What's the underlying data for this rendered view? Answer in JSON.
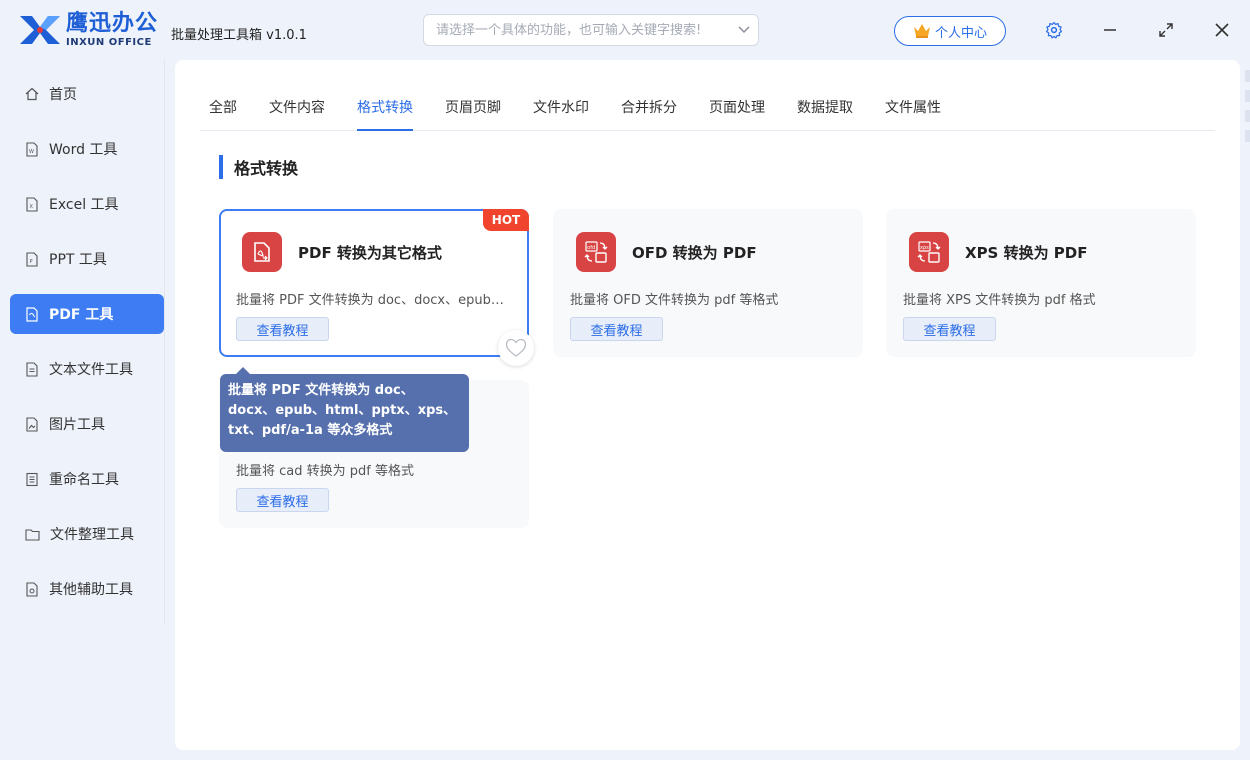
{
  "app": {
    "logo_cn": "鹰迅办公",
    "logo_en": "INXUN OFFICE",
    "title": "批量处理工具箱 v1.0.1"
  },
  "search": {
    "placeholder": "请选择一个具体的功能，也可输入关键字搜索!",
    "value": ""
  },
  "header": {
    "personal_center": "个人中心"
  },
  "sidebar": {
    "items": [
      {
        "label": "首页",
        "icon": "home-icon"
      },
      {
        "label": "Word 工具",
        "icon": "word-file-icon"
      },
      {
        "label": "Excel 工具",
        "icon": "excel-file-icon"
      },
      {
        "label": "PPT 工具",
        "icon": "ppt-file-icon"
      },
      {
        "label": "PDF 工具",
        "icon": "pdf-file-icon",
        "active": true
      },
      {
        "label": "文本文件工具",
        "icon": "text-file-icon"
      },
      {
        "label": "图片工具",
        "icon": "image-file-icon"
      },
      {
        "label": "重命名工具",
        "icon": "rename-icon"
      },
      {
        "label": "文件整理工具",
        "icon": "folder-icon"
      },
      {
        "label": "其他辅助工具",
        "icon": "tools-icon"
      }
    ]
  },
  "tabs": [
    {
      "label": "全部"
    },
    {
      "label": "文件内容"
    },
    {
      "label": "格式转换",
      "active": true
    },
    {
      "label": "页眉页脚"
    },
    {
      "label": "文件水印"
    },
    {
      "label": "合并拆分"
    },
    {
      "label": "页面处理"
    },
    {
      "label": "数据提取"
    },
    {
      "label": "文件属性"
    }
  ],
  "section": {
    "title": "格式转换"
  },
  "cards": [
    {
      "title": "PDF 转换为其它格式",
      "desc": "批量将 PDF 文件转换为 doc、docx、epub、html、pptx、xps、txt、pdf/a-1a 等众多格式",
      "button": "查看教程",
      "badge": "HOT"
    },
    {
      "title": "OFD 转换为 PDF",
      "desc": "批量将 OFD 文件转换为 pdf 等格式",
      "button": "查看教程",
      "icon_text": "ofd"
    },
    {
      "title": "XPS 转换为 PDF",
      "desc": "批量将 XPS 文件转换为 pdf 格式",
      "button": "查看教程",
      "icon_text": "xps"
    },
    {
      "desc": "批量将 cad 转换为 pdf 等格式",
      "button": "查看教程"
    }
  ],
  "tooltip": {
    "text": "批量将 PDF 文件转换为 doc、docx、epub、html、pptx、xps、txt、pdf/a-1a 等众多格式"
  },
  "colors": {
    "accent": "#3d7cf2",
    "icon_red": "#d84444",
    "hot_badge": "#f0442e",
    "tooltip_bg": "#5670ad"
  }
}
